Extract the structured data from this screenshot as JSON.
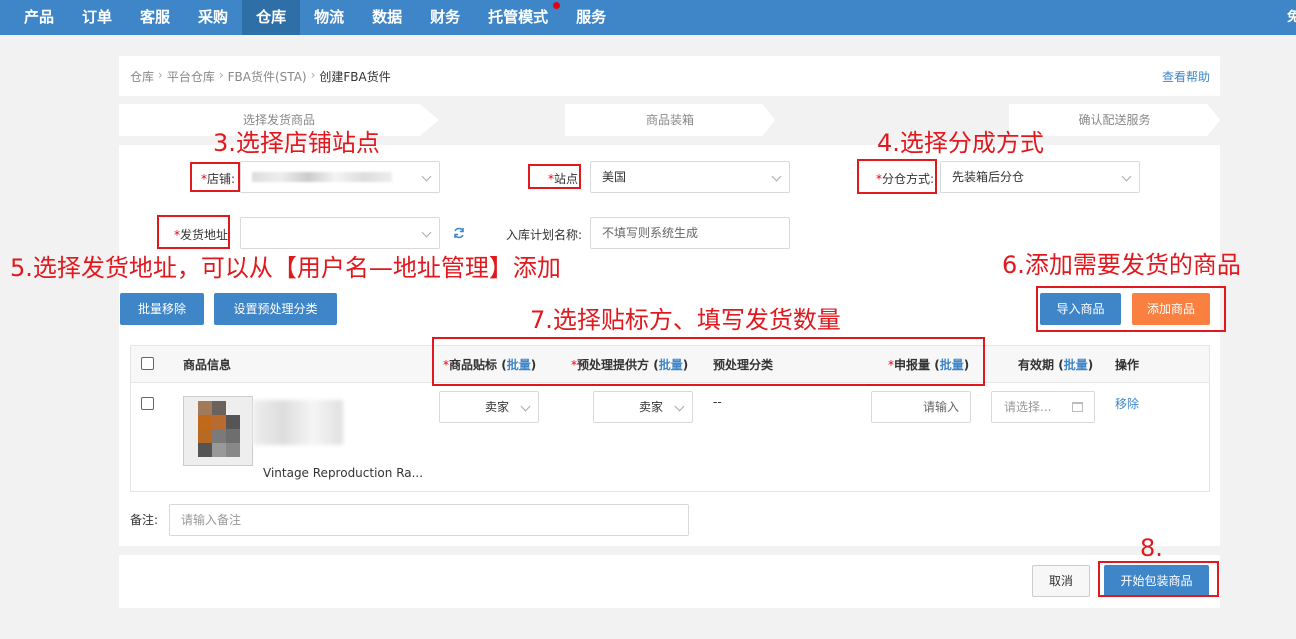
{
  "nav": {
    "items": [
      "产品",
      "订单",
      "客服",
      "采购",
      "仓库",
      "物流",
      "数据",
      "财务",
      "托管模式",
      "服务"
    ],
    "active": "仓库",
    "right_text": "免"
  },
  "breadcrumb": {
    "items": [
      "仓库",
      "平台仓库",
      "FBA货件(STA)",
      "创建FBA货件"
    ],
    "help": "查看帮助"
  },
  "steps": [
    "选择发货商品",
    "商品装箱",
    "确认配送服务"
  ],
  "form": {
    "store_label": "店铺:",
    "site_label": "站点",
    "site_value": "美国",
    "split_label": "分仓方式:",
    "split_value": "先装箱后分仓",
    "address_label": "发货地址",
    "plan_label": "入库计划名称:",
    "plan_placeholder": "不填写则系统生成"
  },
  "annotations": {
    "a3": "3.选择店铺站点",
    "a4": "4.选择分成方式",
    "a5": "5.选择发货地址，可以从【用户名—地址管理】添加",
    "a6": "6.添加需要发货的商品",
    "a7": "7.选择贴标方、填写发货数量",
    "a8": "8."
  },
  "toolbar": {
    "batch_remove": "批量移除",
    "set_prep": "设置预处理分类",
    "import": "导入商品",
    "add": "添加商品"
  },
  "table": {
    "headers": {
      "info": "商品信息",
      "label": "商品贴标",
      "prep_provider": "预处理提供方",
      "prep_category": "预处理分类",
      "declared": "申报量",
      "expiry": "有效期",
      "ops": "操作",
      "batch": "批量"
    },
    "row": {
      "name": "Vintage Reproduction Ra...",
      "label_value": "卖家",
      "prep_value": "卖家",
      "prep_category": "--",
      "declared_placeholder": "请输入",
      "expiry_placeholder": "请选择...",
      "remove": "移除"
    }
  },
  "remark": {
    "label": "备注:",
    "placeholder": "请输入备注"
  },
  "footer": {
    "cancel": "取消",
    "start": "开始包装商品"
  },
  "colors": {
    "brand": "#3f86c8",
    "accent": "#f98040",
    "annotation": "#e1191e"
  }
}
